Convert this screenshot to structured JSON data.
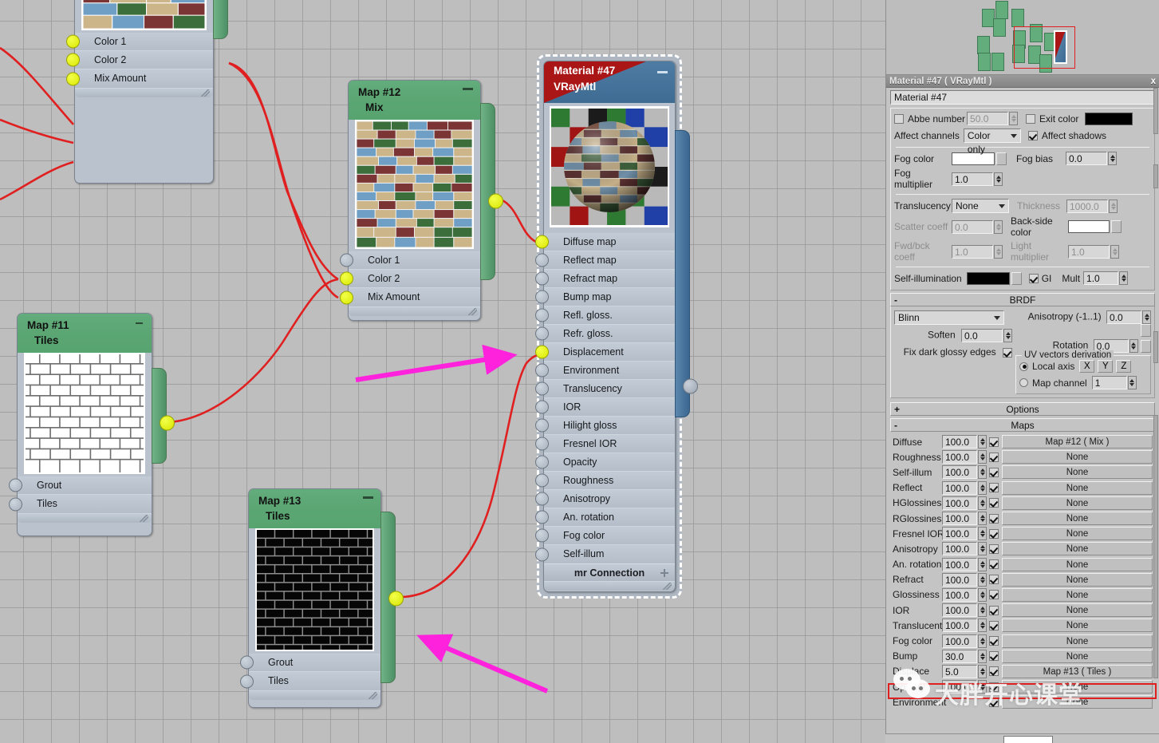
{
  "app": {
    "editor": "Slate Material Editor"
  },
  "nodes": [
    {
      "id": "map10",
      "title": "",
      "subtitle": "",
      "type": "mix",
      "sockets": [
        {
          "label": "Color 1",
          "connected": true
        },
        {
          "label": "Color 2",
          "connected": true
        },
        {
          "label": "Mix Amount",
          "connected": true
        }
      ],
      "output_connected": true
    },
    {
      "id": "map12",
      "title": "Map #12",
      "subtitle": "Mix",
      "type": "mix",
      "sockets": [
        {
          "label": "Color 1",
          "connected": false
        },
        {
          "label": "Color 2",
          "connected": true
        },
        {
          "label": "Mix Amount",
          "connected": true
        }
      ],
      "output_connected": true
    },
    {
      "id": "map11",
      "title": "Map #11",
      "subtitle": "Tiles",
      "type": "tiles-light",
      "sockets": [
        {
          "label": "Grout",
          "connected": false
        },
        {
          "label": "Tiles",
          "connected": false
        }
      ],
      "output_connected": true
    },
    {
      "id": "map13",
      "title": "Map #13",
      "subtitle": "Tiles",
      "type": "tiles-dark",
      "sockets": [
        {
          "label": "Grout",
          "connected": false
        },
        {
          "label": "Tiles",
          "connected": false
        }
      ],
      "output_connected": true
    }
  ],
  "material_node": {
    "title": "Material #47",
    "subtitle": "VRayMtl",
    "sockets": [
      {
        "label": "Diffuse map",
        "connected": true
      },
      {
        "label": "Reflect map",
        "connected": false
      },
      {
        "label": "Refract map",
        "connected": false
      },
      {
        "label": "Bump map",
        "connected": false
      },
      {
        "label": "Refl. gloss.",
        "connected": false
      },
      {
        "label": "Refr. gloss.",
        "connected": false
      },
      {
        "label": "Displacement",
        "connected": true
      },
      {
        "label": "Environment",
        "connected": false
      },
      {
        "label": "Translucency",
        "connected": false
      },
      {
        "label": "IOR",
        "connected": false
      },
      {
        "label": "Hilight gloss",
        "connected": false
      },
      {
        "label": "Fresnel IOR",
        "connected": false
      },
      {
        "label": "Opacity",
        "connected": false
      },
      {
        "label": "Roughness",
        "connected": false
      },
      {
        "label": "Anisotropy",
        "connected": false
      },
      {
        "label": "An. rotation",
        "connected": false
      },
      {
        "label": "Fog color",
        "connected": false
      },
      {
        "label": "Self-illum",
        "connected": false
      }
    ],
    "mr_connection": "mr Connection"
  },
  "panel": {
    "title": "Material #47  ( VRayMtl )",
    "close_label": "x",
    "name_value": "Material #47",
    "abbe": {
      "label": "Abbe number",
      "checked": false,
      "value": "50.0",
      "exit_color_label": "Exit color",
      "exit_color_checked": false,
      "exit_color": "#000000"
    },
    "affect": {
      "label": "Affect channels",
      "value": "Color only",
      "shadows_label": "Affect shadows",
      "shadows_checked": true
    },
    "fog": {
      "color_label": "Fog color",
      "color": "#ffffff",
      "bias_label": "Fog bias",
      "bias_value": "0.0",
      "mult_label": "Fog multiplier",
      "mult_value": "1.0"
    },
    "translucency": {
      "label": "Translucency",
      "value": "None",
      "thickness_label": "Thickness",
      "thickness_value": "1000.0",
      "scatter_label": "Scatter coeff",
      "scatter_value": "0.0",
      "backside_label": "Back-side color",
      "backside_color": "#ffffff",
      "fwdbck_label": "Fwd/bck coeff",
      "fwdbck_value": "1.0",
      "lightmult_label": "Light multiplier",
      "lightmult_value": "1.0"
    },
    "selfillum": {
      "label": "Self-illumination",
      "color": "#000000",
      "gi_label": "GI",
      "gi_checked": true,
      "mult_label": "Mult",
      "mult_value": "1.0"
    },
    "brdf": {
      "header": "BRDF",
      "sign": "-",
      "model": "Blinn",
      "aniso_label": "Anisotropy (-1..1)",
      "aniso_value": "0.0",
      "rotation_label": "Rotation",
      "rotation_value": "0.0",
      "soften_label": "Soften",
      "soften_value": "0.0",
      "fixdark_label": "Fix dark glossy edges",
      "fixdark_checked": true,
      "uv_caption": "UV vectors derivation",
      "local_axis_label": "Local axis",
      "local_axis_selected": true,
      "axis_x": "X",
      "axis_y": "Y",
      "axis_z": "Z",
      "map_channel_label": "Map channel",
      "map_channel_selected": false,
      "map_channel_value": "1"
    },
    "options_rollup": {
      "sign": "+",
      "header": "Options"
    },
    "maps_rollup": {
      "sign": "-",
      "header": "Maps"
    },
    "maps": [
      {
        "label": "Diffuse",
        "amount": "100.0",
        "enabled": true,
        "map": "Map #12  ( Mix )",
        "spinner": true
      },
      {
        "label": "Roughness",
        "amount": "100.0",
        "enabled": true,
        "map": "None",
        "spinner": true
      },
      {
        "label": "Self-illum",
        "amount": "100.0",
        "enabled": true,
        "map": "None",
        "spinner": true
      },
      {
        "label": "Reflect",
        "amount": "100.0",
        "enabled": true,
        "map": "None",
        "spinner": true
      },
      {
        "label": "HGlossiness",
        "amount": "100.0",
        "enabled": true,
        "map": "None",
        "spinner": true
      },
      {
        "label": "RGlossiness",
        "amount": "100.0",
        "enabled": true,
        "map": "None",
        "spinner": true
      },
      {
        "label": "Fresnel IOR",
        "amount": "100.0",
        "enabled": true,
        "map": "None",
        "spinner": true
      },
      {
        "label": "Anisotropy",
        "amount": "100.0",
        "enabled": true,
        "map": "None",
        "spinner": true
      },
      {
        "label": "An. rotation",
        "amount": "100.0",
        "enabled": true,
        "map": "None",
        "spinner": true
      },
      {
        "label": "Refract",
        "amount": "100.0",
        "enabled": true,
        "map": "None",
        "spinner": true
      },
      {
        "label": "Glossiness",
        "amount": "100.0",
        "enabled": true,
        "map": "None",
        "spinner": true
      },
      {
        "label": "IOR",
        "amount": "100.0",
        "enabled": true,
        "map": "None",
        "spinner": true
      },
      {
        "label": "Translucent",
        "amount": "100.0",
        "enabled": true,
        "map": "None",
        "spinner": true
      },
      {
        "label": "Fog color",
        "amount": "100.0",
        "enabled": true,
        "map": "None",
        "spinner": true
      },
      {
        "label": "Bump",
        "amount": "30.0",
        "enabled": true,
        "map": "None",
        "spinner": true
      },
      {
        "label": "Displace",
        "amount": "5.0",
        "enabled": true,
        "map": "Map #13  ( Tiles )",
        "spinner": true
      },
      {
        "label": "Opacity",
        "amount": "100.0",
        "enabled": true,
        "map": "None",
        "spinner": true
      },
      {
        "label": "Environment",
        "amount": "",
        "enabled": true,
        "map": "None",
        "spinner": false
      }
    ]
  },
  "watermark": {
    "text": "大胖开心课堂",
    "accent": "#e02020"
  },
  "annotations": [
    {
      "name": "arrow-to-displacement",
      "color": "#ff22dd"
    },
    {
      "name": "arrow-to-map13",
      "color": "#ff22dd"
    }
  ],
  "navigator": {
    "viewport_rect_color": "#e02020",
    "node_color": "#63ac7c"
  }
}
